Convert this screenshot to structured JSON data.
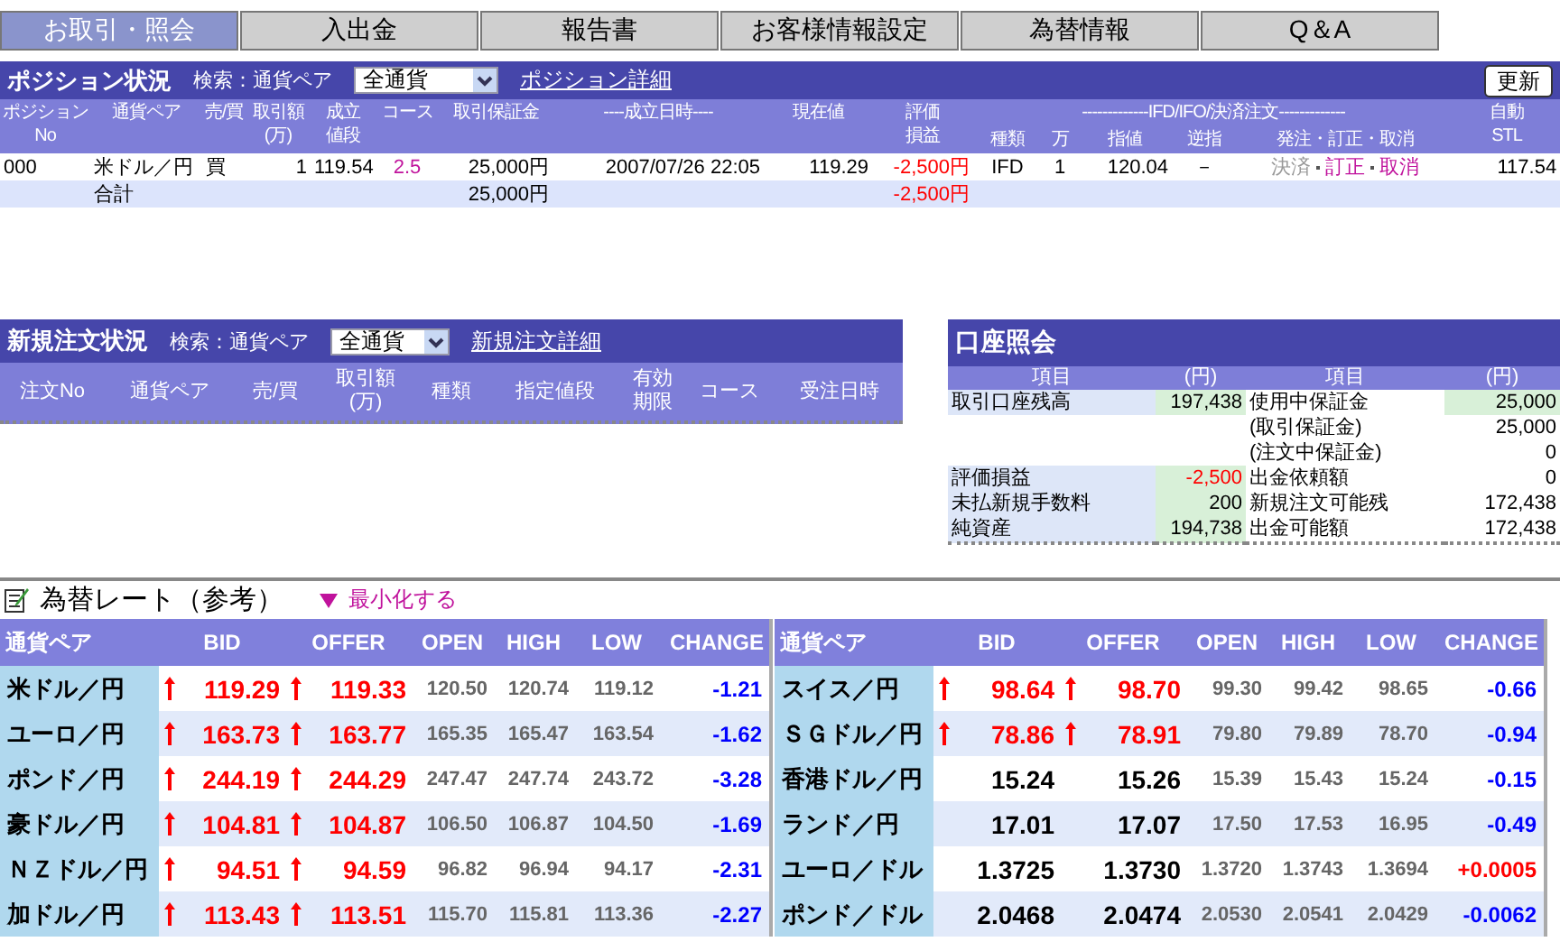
{
  "nav_tabs": [
    {
      "label": "お取引・照会",
      "selected": true
    },
    {
      "label": "入出金",
      "selected": false
    },
    {
      "label": "報告書",
      "selected": false
    },
    {
      "label": "お客様情報設定",
      "selected": false
    },
    {
      "label": "為替情報",
      "selected": false
    },
    {
      "label": "Q＆A",
      "selected": false
    }
  ],
  "positions": {
    "title": "ポジション状況",
    "search_label": "検索：通貨ペア",
    "filter": "全通貨",
    "detail_link": "ポジション詳細",
    "refresh_button": "更新",
    "columns": [
      "ポジション\nNo",
      "通貨ペア",
      "売/買",
      "取引額\n(万)",
      "成立値段",
      "コース",
      "取引保証金",
      "----成立日時----",
      "現在値",
      "評価損益"
    ],
    "order_group": {
      "label": "-------------IFD/IFO/決済注文-------------",
      "columns": [
        "種類",
        "万",
        "指値",
        "逆指",
        "発注・訂正・取消"
      ]
    },
    "stl_column": "自動\nSTL",
    "rows": [
      {
        "no": "000",
        "pair": "米ドル／円",
        "side": "買",
        "amount": "1",
        "price": "119.54",
        "course": "2.5",
        "margin": "25,000円",
        "datetime": "2007/07/26 22:05",
        "current": "119.29",
        "pnl": "-2,500円",
        "order_type": "IFD",
        "order_amount": "1",
        "limit": "120.04",
        "stop": "－",
        "actions": [
          {
            "label": "決済",
            "disabled": true
          },
          {
            "label": "訂正",
            "disabled": false
          },
          {
            "label": "取消",
            "disabled": false
          }
        ],
        "stl": "117.54"
      }
    ],
    "total": {
      "label": "合計",
      "margin": "25,000円",
      "pnl": "-2,500円"
    }
  },
  "new_orders": {
    "title": "新規注文状況",
    "search_label": "検索：通貨ペア",
    "filter": "全通貨",
    "detail_link": "新規注文詳細",
    "columns": [
      "注文No",
      "通貨ペア",
      "売/買",
      "取引額\n(万)",
      "種類",
      "指定値段",
      "有効期限",
      "コース",
      "受注日時"
    ]
  },
  "account": {
    "title": "口座照会",
    "columns": [
      "項目",
      "(円)",
      "項目",
      "(円)"
    ],
    "rows": [
      {
        "left": {
          "label": "取引口座残高",
          "value": "197,438",
          "negative": false
        },
        "right": {
          "label": "使用中保証金",
          "value": "25,000"
        }
      },
      {
        "right": {
          "label": "(取引保証金)",
          "value": "25,000"
        }
      },
      {
        "right": {
          "label": "(注文中保証金)",
          "value": "0"
        }
      },
      {
        "left": {
          "label": "評価損益",
          "value": "-2,500",
          "negative": true
        },
        "right": {
          "label": "出金依頼額",
          "value": "0"
        }
      },
      {
        "left": {
          "label": "未払新規手数料",
          "value": "200",
          "negative": false
        },
        "right": {
          "label": "新規注文可能残",
          "value": "172,438"
        }
      },
      {
        "left": {
          "label": "純資産",
          "value": "194,738",
          "negative": false
        },
        "right": {
          "label": "出金可能額",
          "value": "172,438"
        }
      }
    ]
  },
  "rates": {
    "title": "為替レート（参考）",
    "minimize_link": "最小化する",
    "tables": [
      {
        "columns": [
          "通貨ペア",
          "BID",
          "OFFER",
          "OPEN",
          "HIGH",
          "LOW",
          "CHANGE"
        ],
        "rows": [
          {
            "pair": "米ドル／円",
            "bid_up": true,
            "bid": "119.29",
            "offer_up": true,
            "offer": "119.33",
            "open": "120.50",
            "high": "120.74",
            "low": "119.12",
            "change": "-1.21",
            "change_up": false
          },
          {
            "pair": "ユーロ／円",
            "bid_up": true,
            "bid": "163.73",
            "offer_up": true,
            "offer": "163.77",
            "open": "165.35",
            "high": "165.47",
            "low": "163.54",
            "change": "-1.62",
            "change_up": false
          },
          {
            "pair": "ポンド／円",
            "bid_up": true,
            "bid": "244.19",
            "offer_up": true,
            "offer": "244.29",
            "open": "247.47",
            "high": "247.74",
            "low": "243.72",
            "change": "-3.28",
            "change_up": false
          },
          {
            "pair": "豪ドル／円",
            "bid_up": true,
            "bid": "104.81",
            "offer_up": true,
            "offer": "104.87",
            "open": "106.50",
            "high": "106.87",
            "low": "104.50",
            "change": "-1.69",
            "change_up": false
          },
          {
            "pair": "ＮＺドル／円",
            "bid_up": true,
            "bid": "94.51",
            "offer_up": true,
            "offer": "94.59",
            "open": "96.82",
            "high": "96.94",
            "low": "94.17",
            "change": "-2.31",
            "change_up": false
          },
          {
            "pair": "加ドル／円",
            "bid_up": true,
            "bid": "113.43",
            "offer_up": true,
            "offer": "113.51",
            "open": "115.70",
            "high": "115.81",
            "low": "113.36",
            "change": "-2.27",
            "change_up": false
          }
        ]
      },
      {
        "columns": [
          "通貨ペア",
          "BID",
          "OFFER",
          "OPEN",
          "HIGH",
          "LOW",
          "CHANGE"
        ],
        "rows": [
          {
            "pair": "スイス／円",
            "bid_up": true,
            "bid": "98.64",
            "offer_up": true,
            "offer": "98.70",
            "open": "99.30",
            "high": "99.42",
            "low": "98.65",
            "change": "-0.66",
            "change_up": false
          },
          {
            "pair": "ＳＧドル／円",
            "bid_up": true,
            "bid": "78.86",
            "offer_up": true,
            "offer": "78.91",
            "open": "79.80",
            "high": "79.89",
            "low": "78.70",
            "change": "-0.94",
            "change_up": false
          },
          {
            "pair": "香港ドル／円",
            "bid_up": false,
            "bid": "15.24",
            "offer_up": false,
            "offer": "15.26",
            "open": "15.39",
            "high": "15.43",
            "low": "15.24",
            "change": "-0.15",
            "change_up": false
          },
          {
            "pair": "ランド／円",
            "bid_up": false,
            "bid": "17.01",
            "offer_up": false,
            "offer": "17.07",
            "open": "17.50",
            "high": "17.53",
            "low": "16.95",
            "change": "-0.49",
            "change_up": false
          },
          {
            "pair": "ユーロ／ドル",
            "bid_up": false,
            "bid": "1.3725",
            "offer_up": false,
            "offer": "1.3730",
            "open": "1.3720",
            "high": "1.3743",
            "low": "1.3694",
            "change": "+0.0005",
            "change_up": true
          },
          {
            "pair": "ポンド／ドル",
            "bid_up": false,
            "bid": "2.0468",
            "offer_up": false,
            "offer": "2.0474",
            "open": "2.0530",
            "high": "2.0541",
            "low": "2.0429",
            "change": "-0.0062",
            "change_up": false
          }
        ]
      }
    ]
  }
}
